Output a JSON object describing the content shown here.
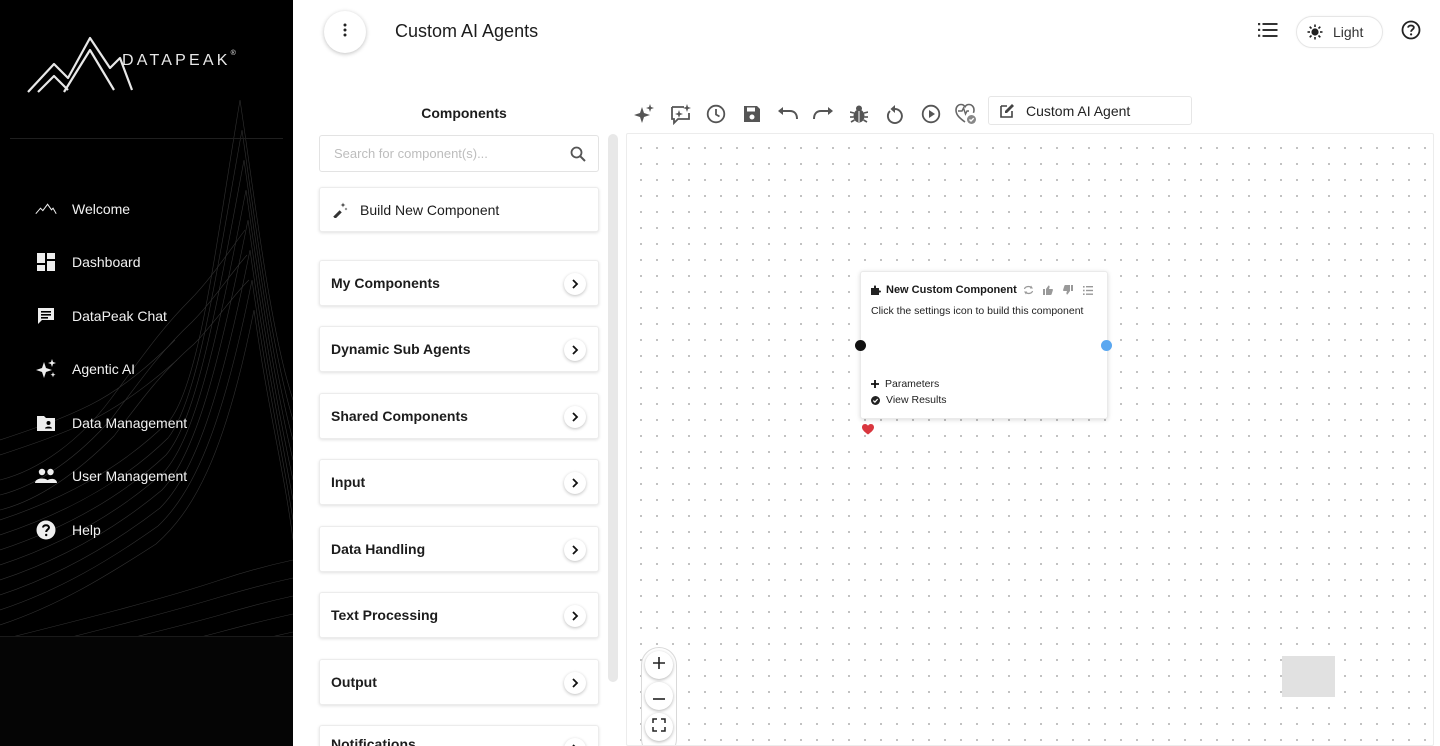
{
  "brand": {
    "name": "DATAPEAK",
    "mark": "®"
  },
  "nav": [
    {
      "label": "Welcome",
      "icon": "mountain-icon"
    },
    {
      "label": "Dashboard",
      "icon": "dashboard-icon"
    },
    {
      "label": "DataPeak Chat",
      "icon": "chat-icon"
    },
    {
      "label": "Agentic AI",
      "icon": "sparkle-icon"
    },
    {
      "label": "Data Management",
      "icon": "folder-user-icon"
    },
    {
      "label": "User Management",
      "icon": "users-icon"
    },
    {
      "label": "Help",
      "icon": "help-icon"
    }
  ],
  "header": {
    "title": "Custom AI Agents",
    "theme_label": "Light"
  },
  "components": {
    "title": "Components",
    "search_placeholder": "Search for component(s)...",
    "build_label": "Build New Component",
    "categories": [
      "My Components",
      "Dynamic Sub Agents",
      "Shared Components",
      "Input",
      "Data Handling",
      "Text Processing",
      "Output",
      "Notifications"
    ]
  },
  "toolbar": {
    "icons": [
      "magic-icon",
      "ai-chat-icon",
      "history-icon",
      "save-icon",
      "undo-icon",
      "redo-icon",
      "debug-icon",
      "reset-icon",
      "run-icon",
      "heart-check-icon"
    ],
    "agent_name": "Custom AI Agent"
  },
  "node": {
    "title": "New Custom Component",
    "description": "Click the settings icon to build this component",
    "parameters_label": "Parameters",
    "results_label": "View Results"
  },
  "colors": {
    "sidebar_bg": "#000000",
    "port_in": "#111111",
    "port_out": "#5aa7f0",
    "heart": "#d9363e"
  }
}
